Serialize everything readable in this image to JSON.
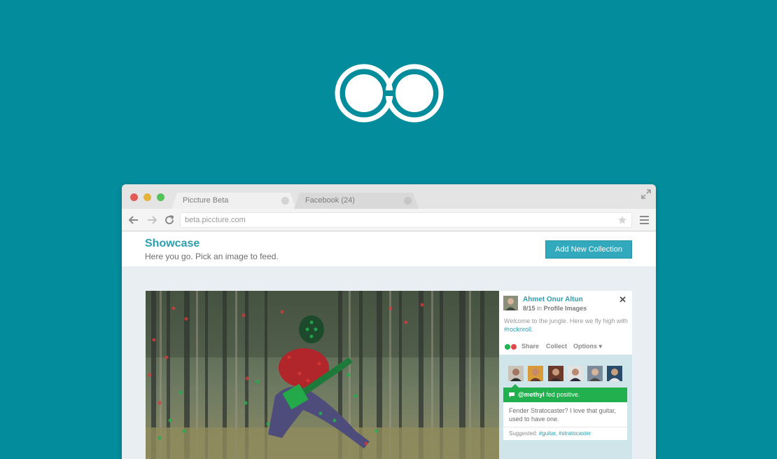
{
  "brand": {
    "logo": "double-ring-logo",
    "bg_color": "#028c9c"
  },
  "browser": {
    "tabs": [
      {
        "label": "Piccture Beta",
        "active": true
      },
      {
        "label": "Facebook (24)",
        "active": false
      }
    ],
    "url": "beta.piccture.com"
  },
  "page": {
    "title": "Showcase",
    "subtitle": "Here you go. Pick an image to feed.",
    "add_button": "Add New Collection"
  },
  "post": {
    "author": "Ahmet Onur Altun",
    "count": "8/15",
    "in_word": "in",
    "collection": "Profile Images",
    "caption": "Welcome to the jungle. Here we fly high with ",
    "caption_tag": "#rocknroll",
    "caption_end": ".",
    "actions": {
      "share": "Share",
      "collect": "Collect",
      "options": "Options ▾"
    }
  },
  "feed": {
    "notification_user": "@methyl",
    "notification_text": " fed positive.",
    "comment": "Fender Stratocaster? I love that guitar, used to have one.",
    "suggested_label": "Suggested: ",
    "suggested_tags": "#guitar, #stratocaster"
  }
}
